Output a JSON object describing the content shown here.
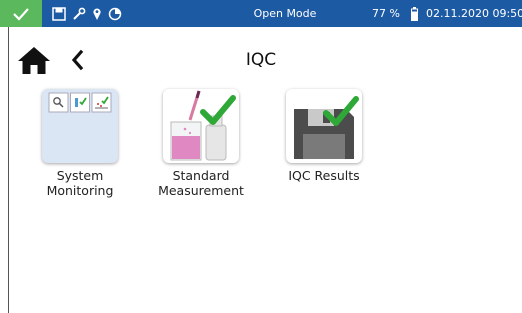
{
  "status_bar": {
    "mode": "Open Mode",
    "battery": "77 %",
    "datetime": "02.11.2020 09:50",
    "icons": [
      "check-icon",
      "save-icon",
      "wrench-icon",
      "location-pin-icon",
      "clock-pie-icon",
      "battery-icon"
    ]
  },
  "nav": {
    "title": "IQC",
    "icons": [
      "home-icon",
      "back-chevron-icon"
    ]
  },
  "tiles": [
    {
      "label": "System\nMonitoring",
      "icon": "system-monitoring-icon"
    },
    {
      "label": "Standard\nMeasurement",
      "icon": "standard-measurement-icon"
    },
    {
      "label": "IQC Results",
      "icon": "iqc-results-icon"
    }
  ],
  "colors": {
    "status_bar": "#1d5aa4",
    "status_ok": "#5cb85c",
    "check_green": "#2ea836",
    "tile_blue": "#dbe6f4"
  }
}
